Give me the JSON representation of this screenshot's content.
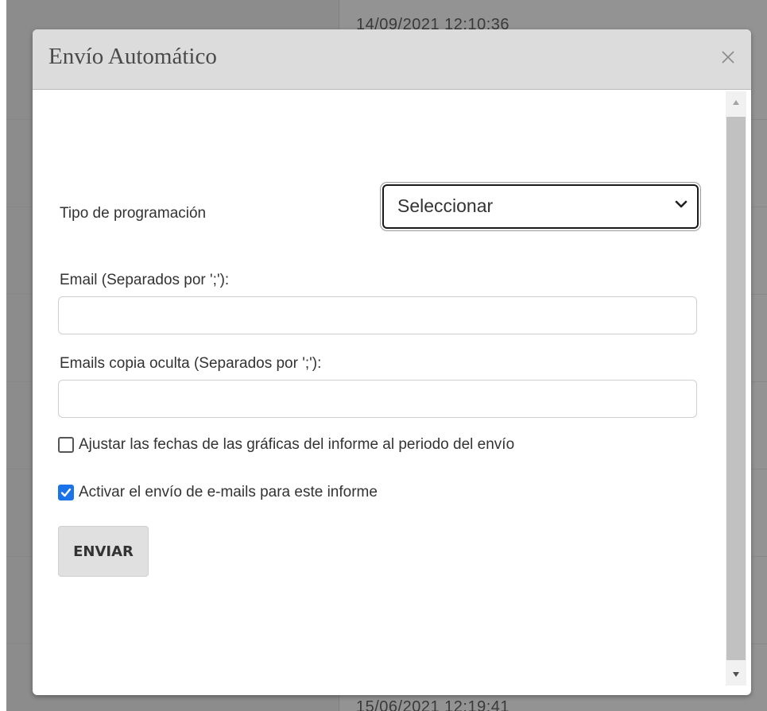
{
  "background": {
    "timestamp_top": "14/09/2021 12:10:36",
    "timestamp_bottom": "15/06/2021 12:19:41"
  },
  "modal": {
    "title": "Envío Automático",
    "close_icon": "close-icon",
    "schedule_type": {
      "label": "Tipo de programación",
      "selected_value": "Seleccionar"
    },
    "email": {
      "label": "Email (Separados por ';'):",
      "value": "",
      "placeholder": ""
    },
    "bcc_email": {
      "label": "Emails copia oculta (Separados por ';'):",
      "value": "",
      "placeholder": ""
    },
    "adjust_dates": {
      "label": "Ajustar las fechas de las gráficas del informe al periodo del envío",
      "checked": false
    },
    "activate_send": {
      "label": "Activar el envío de e-mails para este informe",
      "checked": true
    },
    "send_button_label": "ENVIAR"
  },
  "colors": {
    "checkbox_accent": "#1a73e8",
    "header_bg": "#dcdcdc",
    "backdrop": "#8f8f8f"
  }
}
